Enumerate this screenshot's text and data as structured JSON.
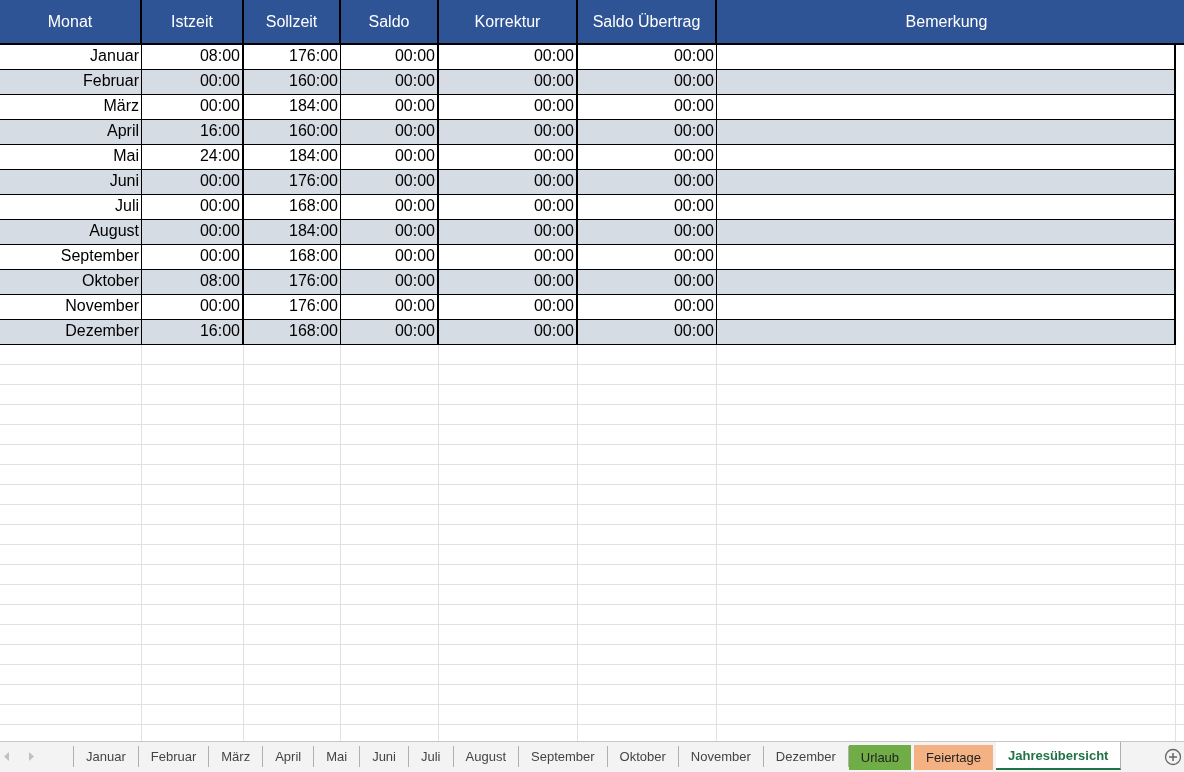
{
  "table": {
    "columns": [
      "Monat",
      "Istzeit",
      "Sollzeit",
      "Saldo",
      "Korrektur",
      "Saldo Übertrag",
      "Bemerkung"
    ],
    "rows": [
      [
        "Januar",
        "08:00",
        "176:00",
        "00:00",
        "00:00",
        "00:00"
      ],
      [
        "Februar",
        "00:00",
        "160:00",
        "00:00",
        "00:00",
        "00:00"
      ],
      [
        "März",
        "00:00",
        "184:00",
        "00:00",
        "00:00",
        "00:00"
      ],
      [
        "April",
        "16:00",
        "160:00",
        "00:00",
        "00:00",
        "00:00"
      ],
      [
        "Mai",
        "24:00",
        "184:00",
        "00:00",
        "00:00",
        "00:00"
      ],
      [
        "Juni",
        "00:00",
        "176:00",
        "00:00",
        "00:00",
        "00:00"
      ],
      [
        "Juli",
        "00:00",
        "168:00",
        "00:00",
        "00:00",
        "00:00"
      ],
      [
        "August",
        "00:00",
        "184:00",
        "00:00",
        "00:00",
        "00:00"
      ],
      [
        "September",
        "00:00",
        "168:00",
        "00:00",
        "00:00",
        "00:00"
      ],
      [
        "Oktober",
        "08:00",
        "176:00",
        "00:00",
        "00:00",
        "00:00"
      ],
      [
        "November",
        "00:00",
        "176:00",
        "00:00",
        "00:00",
        "00:00"
      ],
      [
        "Dezember",
        "16:00",
        "168:00",
        "00:00",
        "00:00",
        "00:00"
      ]
    ]
  },
  "sheet_tabs": [
    {
      "label": "Januar",
      "selected": false
    },
    {
      "label": "Februar",
      "selected": false
    },
    {
      "label": "März",
      "selected": false
    },
    {
      "label": "April",
      "selected": false
    },
    {
      "label": "Mai",
      "selected": false
    },
    {
      "label": "Juni",
      "selected": false
    },
    {
      "label": "Juli",
      "selected": false
    },
    {
      "label": "August",
      "selected": false
    },
    {
      "label": "September",
      "selected": false
    },
    {
      "label": "Oktober",
      "selected": false
    },
    {
      "label": "November",
      "selected": false
    },
    {
      "label": "Dezember",
      "selected": false
    },
    {
      "label": "Urlaub",
      "selected": false,
      "color": "#70ad47"
    },
    {
      "label": "Feiertage",
      "selected": false,
      "color": "#f4b183"
    },
    {
      "label": "Jahresübersicht",
      "selected": true
    }
  ]
}
